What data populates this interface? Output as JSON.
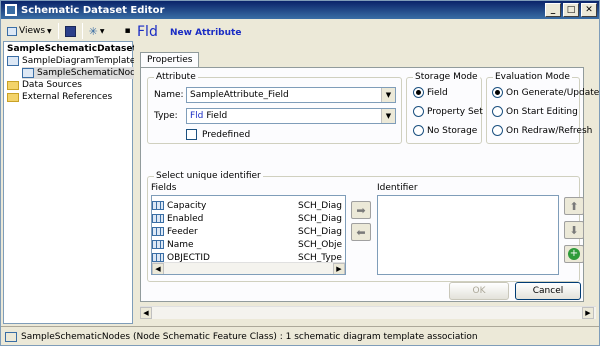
{
  "window": {
    "title": "Schematic Dataset Editor"
  },
  "toolbar": {
    "views_label": "Views"
  },
  "tree": {
    "root": "SampleSchematicDataset",
    "items": [
      {
        "label": "SampleDiagramTemplate",
        "depth": 1
      },
      {
        "label": "SampleSchematicNodes",
        "depth": 2
      },
      {
        "label": "Data Sources",
        "depth": 1
      },
      {
        "label": "External References",
        "depth": 1
      }
    ]
  },
  "header": {
    "icon_text": "Fld",
    "title": "New Attribute"
  },
  "tabs": [
    {
      "label": "Properties"
    }
  ],
  "attribute": {
    "group_label": "Attribute",
    "name_label": "Name:",
    "name_value": "SampleAttribute_Field",
    "type_label": "Type:",
    "type_icon_text": "Fld",
    "type_value": "Field",
    "predefined_label": "Predefined"
  },
  "storage": {
    "group_label": "Storage Mode",
    "options": [
      "Field",
      "Property Set",
      "No Storage"
    ],
    "selected": "Field"
  },
  "evaluation": {
    "group_label": "Evaluation Mode",
    "options": [
      "On Generate/Update",
      "On Start Editing",
      "On Redraw/Refresh"
    ],
    "selected": "On Generate/Update"
  },
  "identifier": {
    "group_label": "Select unique identifier",
    "fields_header": "Fields",
    "identifier_header": "Identifier",
    "fields": [
      {
        "name": "Capacity",
        "source": "SCH_Diag"
      },
      {
        "name": "Enabled",
        "source": "SCH_Diag"
      },
      {
        "name": "Feeder",
        "source": "SCH_Diag"
      },
      {
        "name": "Name",
        "source": "SCH_Obje"
      },
      {
        "name": "OBJECTID",
        "source": "SCH_Type"
      }
    ]
  },
  "buttons": {
    "ok": "OK",
    "cancel": "Cancel"
  },
  "status": {
    "text": "SampleSchematicNodes (Node Schematic Feature Class) : 1 schematic diagram template association"
  }
}
